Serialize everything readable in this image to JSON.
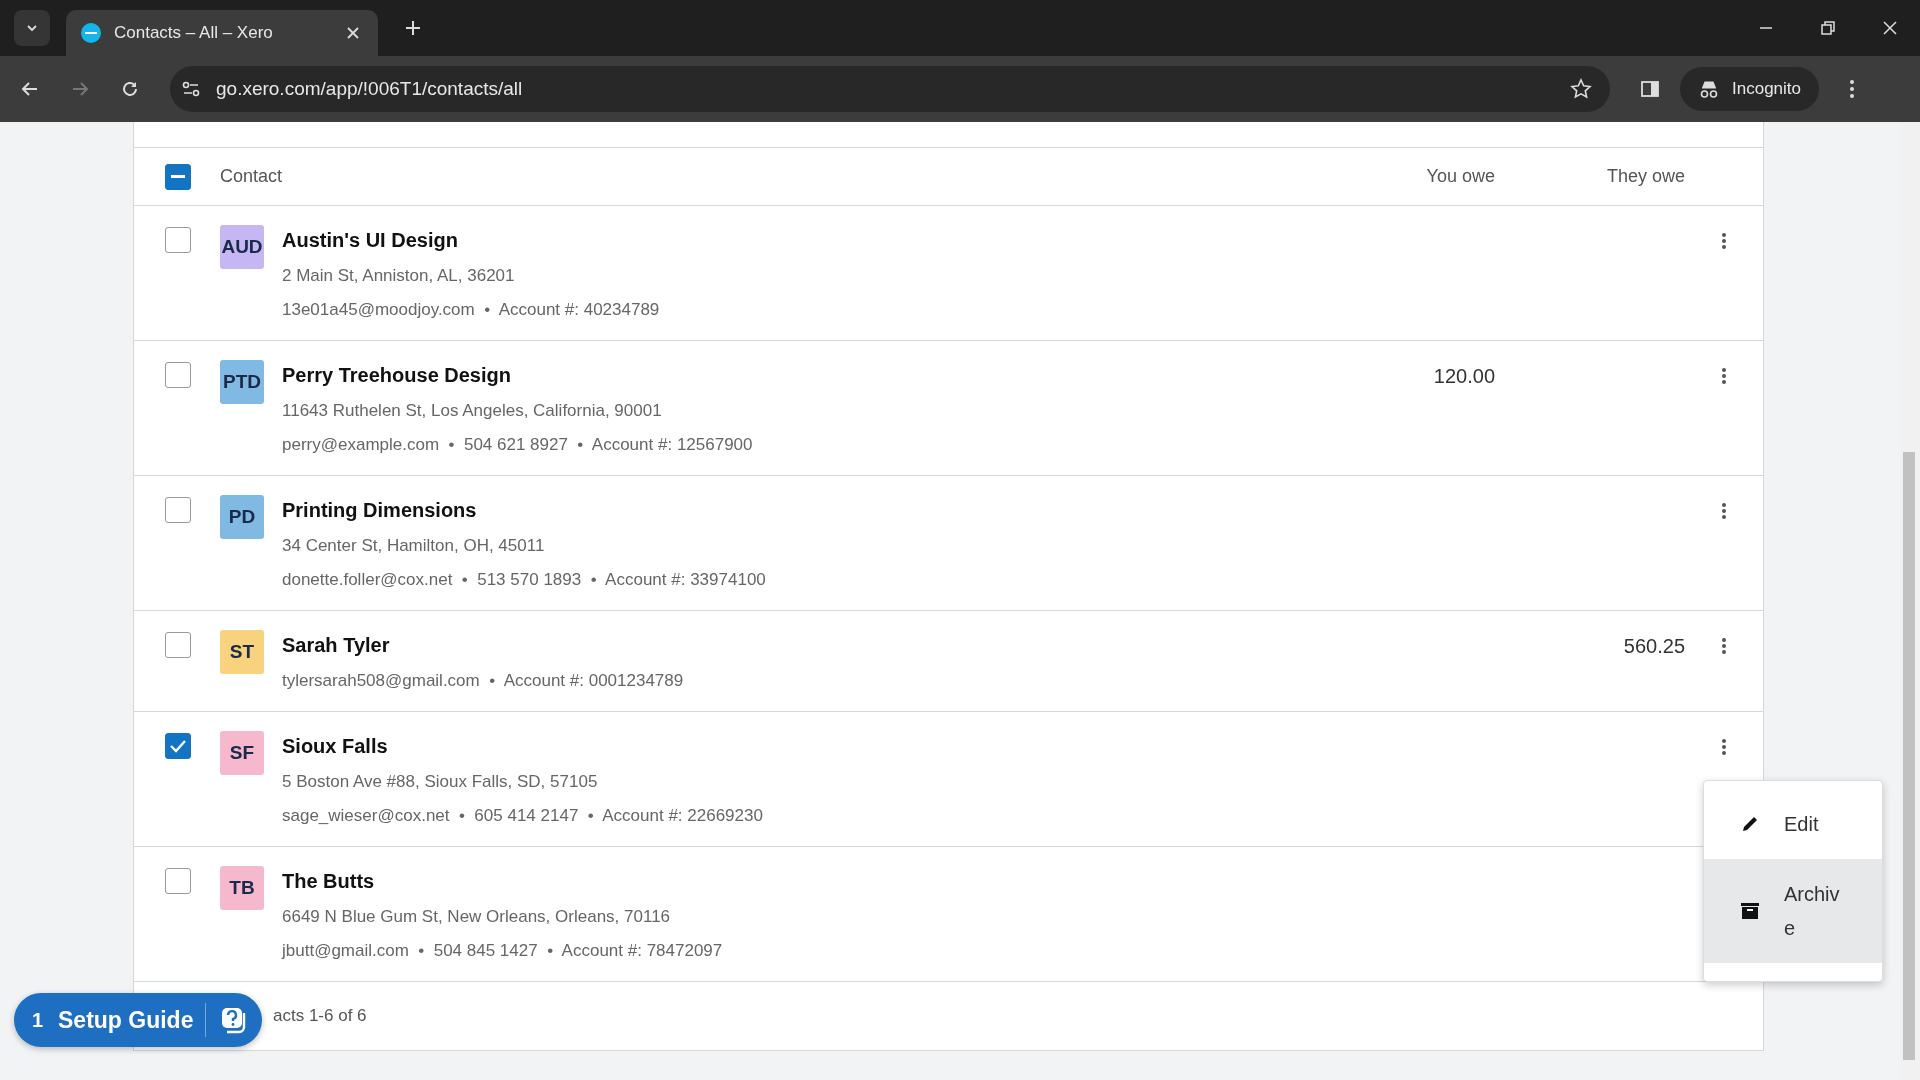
{
  "browser": {
    "tab_title": "Contacts – All – Xero",
    "url": "go.xero.com/app/!006T1/contacts/all",
    "profile_label": "Incognito"
  },
  "table": {
    "select_all": {
      "indeterminate": true
    },
    "columns": [
      "Contact",
      "You owe",
      "They owe"
    ],
    "rows": [
      {
        "initials": "AUD",
        "color": "#c6b6f4",
        "name": "Austin's UI Design",
        "lines": [
          "2 Main St, Anniston, AL, 36201",
          "13e01a45@moodjoy.com  •  Account #: 40234789"
        ],
        "you_owe": "",
        "they_owe": "",
        "checked": false,
        "more_button_visible": true
      },
      {
        "initials": "PTD",
        "color": "#80b9e2",
        "name": "Perry Treehouse Design",
        "lines": [
          "11643 Ruthelen St, Los Angeles, California, 90001",
          "perry@example.com  •  504 621 8927  •  Account #: 12567900"
        ],
        "you_owe": "120.00",
        "they_owe": "",
        "checked": false,
        "more_button_visible": true
      },
      {
        "initials": "PD",
        "color": "#80b9e2",
        "name": "Printing Dimensions",
        "lines": [
          "34 Center St, Hamilton, OH, 45011",
          "donette.foller@cox.net  •  513 570 1893  •  Account #: 33974100"
        ],
        "you_owe": "",
        "they_owe": "",
        "checked": false,
        "more_button_visible": true
      },
      {
        "initials": "ST",
        "color": "#f8d27c",
        "name": "Sarah Tyler",
        "lines": [
          "tylersarah508@gmail.com  •  Account #: 0001234789"
        ],
        "you_owe": "",
        "they_owe": "560.25",
        "checked": false,
        "more_button_visible": true
      },
      {
        "initials": "SF",
        "color": "#f6b8cd",
        "name": "Sioux Falls",
        "lines": [
          "5 Boston Ave #88, Sioux Falls, SD, 57105",
          "sage_wieser@cox.net  •  605 414 2147  •  Account #: 22669230"
        ],
        "you_owe": "",
        "they_owe": "",
        "checked": true,
        "more_button_visible": true
      },
      {
        "initials": "TB",
        "color": "#f6b8cd",
        "name": "The Butts",
        "lines": [
          "6649 N Blue Gum St, New Orleans, Orleans, 70116",
          "jbutt@gmail.com  •  504 845 1427  •  Account #: 78472097"
        ],
        "you_owe": "",
        "they_owe": "",
        "checked": false,
        "more_button_visible": false
      }
    ],
    "footer": "acts 1-6 of 6"
  },
  "menu": {
    "items": [
      {
        "kind": "edit",
        "label": "Edit",
        "hovered": false
      },
      {
        "kind": "archive",
        "label": "Archive",
        "hovered": true
      }
    ]
  },
  "setup_guide": {
    "count": "1",
    "label": "Setup Guide"
  }
}
